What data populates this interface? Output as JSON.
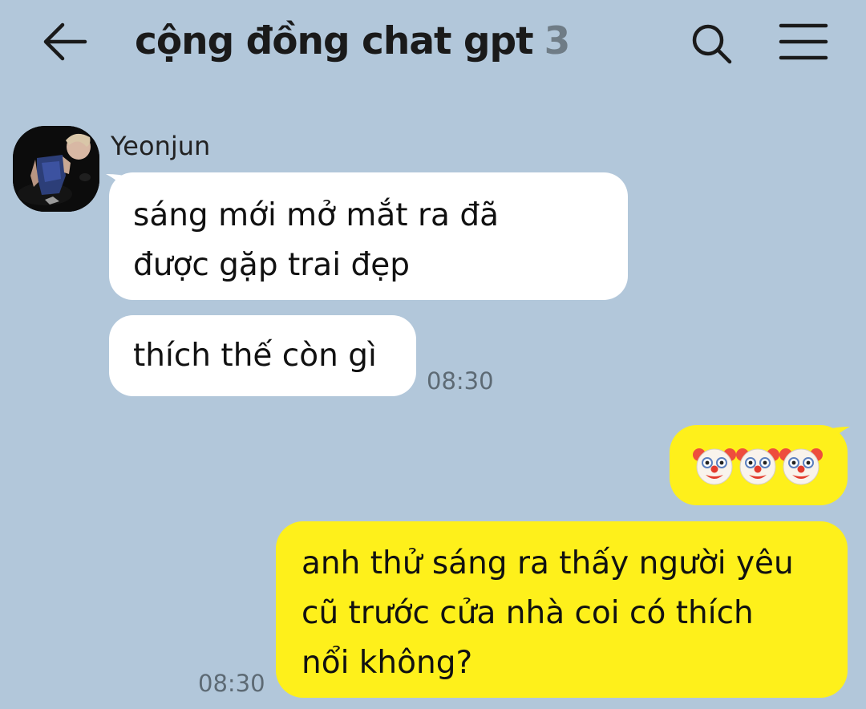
{
  "header": {
    "back_icon": "arrow-left-icon",
    "title": "cộng đồng chat gpt",
    "member_count": "3",
    "search_icon": "search-icon",
    "menu_icon": "hamburger-menu-icon"
  },
  "chat": {
    "sender": {
      "name": "Yeonjun",
      "avatar": "profile-photo"
    },
    "incoming": [
      {
        "lines": [
          "sáng mới mở mắt ra đã",
          "được gặp trai đẹp"
        ]
      },
      {
        "lines": [
          "thích thế còn gì"
        ],
        "time": "08:30"
      }
    ],
    "outgoing": [
      {
        "emoji": [
          "🤡",
          "🤡",
          "🤡"
        ],
        "emoji_icon": "clown-face-icon"
      },
      {
        "lines": [
          "anh thử sáng ra thấy người yêu",
          "cũ trước cửa nhà coi có thích",
          "nổi không?"
        ],
        "time": "08:30"
      }
    ]
  },
  "colors": {
    "background": "#b2c7da",
    "incoming_bubble": "#ffffff",
    "outgoing_bubble": "#fef01b",
    "member_count": "#6f7c86",
    "timestamp": "#5d6a74"
  }
}
